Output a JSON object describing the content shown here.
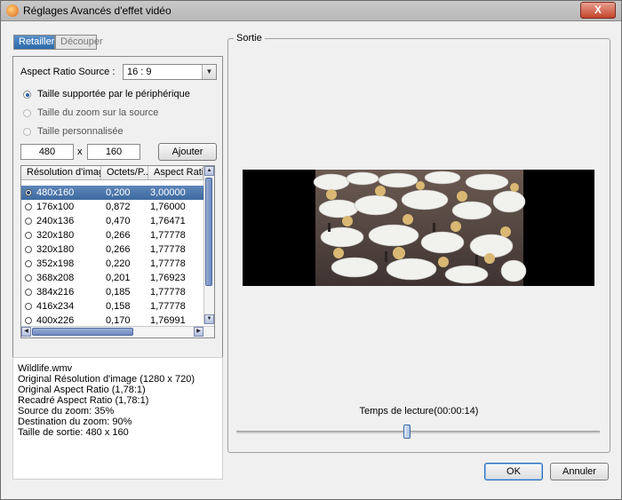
{
  "window": {
    "title": "Réglages Avancés d'effet vidéo",
    "close_label": "X"
  },
  "tabs": [
    {
      "label": "Retailler"
    },
    {
      "label": "Découper"
    }
  ],
  "retailler": {
    "aspect_label": "Aspect Ratio Source :",
    "aspect_value": "16 : 9",
    "options": [
      {
        "label": "Taille supportée par le périphérique",
        "selected": true
      },
      {
        "label": "Taille du zoom sur la source",
        "selected": false
      },
      {
        "label": "Taille personnalisée",
        "selected": false
      }
    ],
    "width_value": "480",
    "times": "x",
    "height_value": "160",
    "add_label": "Ajouter"
  },
  "table": {
    "columns": [
      "Résolution d'image",
      "Octets/P...",
      "Aspect Ratio"
    ],
    "rows": [
      {
        "res": "480x160",
        "bpp": "0,200",
        "ratio": "3,00000",
        "selected": true
      },
      {
        "res": "176x100",
        "bpp": "0,872",
        "ratio": "1,76000"
      },
      {
        "res": "240x136",
        "bpp": "0,470",
        "ratio": "1,76471"
      },
      {
        "res": "320x180",
        "bpp": "0,266",
        "ratio": "1,77778"
      },
      {
        "res": "320x180",
        "bpp": "0,266",
        "ratio": "1,77778"
      },
      {
        "res": "352x198",
        "bpp": "0,220",
        "ratio": "1,77778"
      },
      {
        "res": "368x208",
        "bpp": "0,201",
        "ratio": "1,76923"
      },
      {
        "res": "384x216",
        "bpp": "0,185",
        "ratio": "1,77778"
      },
      {
        "res": "416x234",
        "bpp": "0,158",
        "ratio": "1,77778"
      },
      {
        "res": "400x226",
        "bpp": "0,170",
        "ratio": "1,76991"
      }
    ]
  },
  "info": {
    "lines": [
      "Wildlife.wmv",
      "Original Résolution d'image  (1280 x 720)",
      "Original Aspect Ratio (1,78:1)",
      "Recadré Aspect Ratio (1,78:1)",
      "Source du zoom:  35%",
      "Destination du zoom:  90%",
      "Taille de sortie:  480 x 160"
    ]
  },
  "output": {
    "legend": "Sortie",
    "time_label": "Temps de lecture(00:00:14)",
    "slider_position": 0.47
  },
  "buttons": {
    "ok": "OK",
    "cancel": "Annuler"
  }
}
